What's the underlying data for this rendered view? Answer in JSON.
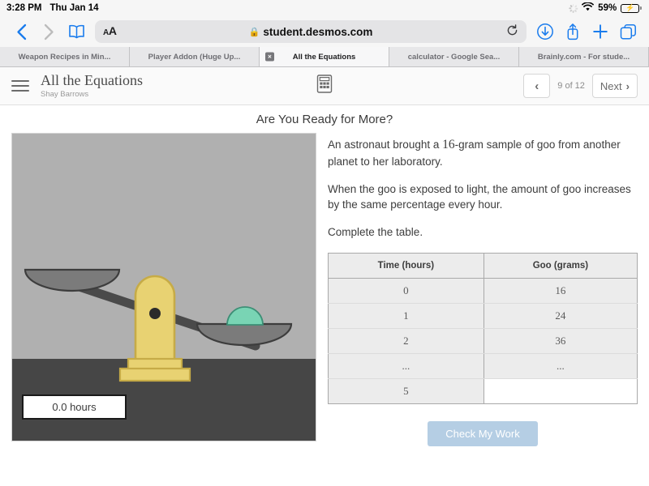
{
  "status_bar": {
    "time": "3:28 PM",
    "date": "Thu Jan 14",
    "battery_percent": "59%",
    "wifi_icon": "wifi-icon",
    "spinner_icon": "activity-spinner-icon",
    "battery_icon": "battery-charging-icon"
  },
  "browser": {
    "back_icon": "chevron-left-icon",
    "forward_icon": "chevron-right-icon",
    "bookmarks_icon": "book-icon",
    "text_size_small": "A",
    "text_size_large": "A",
    "lock_icon": "lock-icon",
    "url": "student.desmos.com",
    "reload_icon": "reload-icon",
    "downloads_icon": "download-icon",
    "share_icon": "share-icon",
    "new_tab_icon": "plus-icon",
    "tabs_overview_icon": "tabs-icon",
    "tabs": [
      {
        "label": "Weapon Recipes in Min...",
        "active": false,
        "closable": false
      },
      {
        "label": "Player Addon (Huge Up...",
        "active": false,
        "closable": false
      },
      {
        "label": "All the Equations",
        "active": true,
        "closable": true,
        "close_label": "×"
      },
      {
        "label": "calculator - Google Sea...",
        "active": false,
        "closable": false
      },
      {
        "label": "Brainly.com - For stude...",
        "active": false,
        "closable": false
      }
    ]
  },
  "app_header": {
    "menu_icon": "hamburger-menu-icon",
    "title": "All the Equations",
    "subtitle": "Shay Barrows",
    "calculator_icon": "calculator-icon",
    "prev_label": "‹",
    "page_indicator": "9 of 12",
    "next_label": "Next",
    "next_icon": "chevron-right-icon"
  },
  "main": {
    "screen_title": "Are You Ready for More?",
    "paragraph_1_before": "An astronaut brought a ",
    "paragraph_1_math": "16",
    "paragraph_1_after": "-gram sample of goo from another planet to her laboratory.",
    "paragraph_2": "When the goo is exposed to light, the amount of goo increases by the same percentage every hour.",
    "paragraph_3": "Complete the table.",
    "check_button": "Check My Work"
  },
  "applet": {
    "hours_readout": "0.0 hours",
    "scale_icon": "balance-scale-illustration",
    "goo_icon": "green-goo-blob",
    "background_color": "#b0b0b0",
    "ground_color": "#464646",
    "scale_color": "#e8d272",
    "beam_color": "#4a4a4a",
    "pan_color": "#7b7b7b",
    "goo_color": "#79d4b4"
  },
  "table": {
    "headers": [
      "Time (hours)",
      "Goo (grams)"
    ],
    "rows": [
      {
        "time": "0",
        "goo": "16",
        "editable": false
      },
      {
        "time": "1",
        "goo": "24",
        "editable": false
      },
      {
        "time": "2",
        "goo": "36",
        "editable": false
      },
      {
        "time": "...",
        "goo": "...",
        "editable": false
      },
      {
        "time": "5",
        "goo": "",
        "editable": true
      }
    ]
  },
  "colors": {
    "accent_blue": "#1a7ced",
    "button_disabled": "#b5cee4",
    "battery_green": "#4cd364"
  }
}
